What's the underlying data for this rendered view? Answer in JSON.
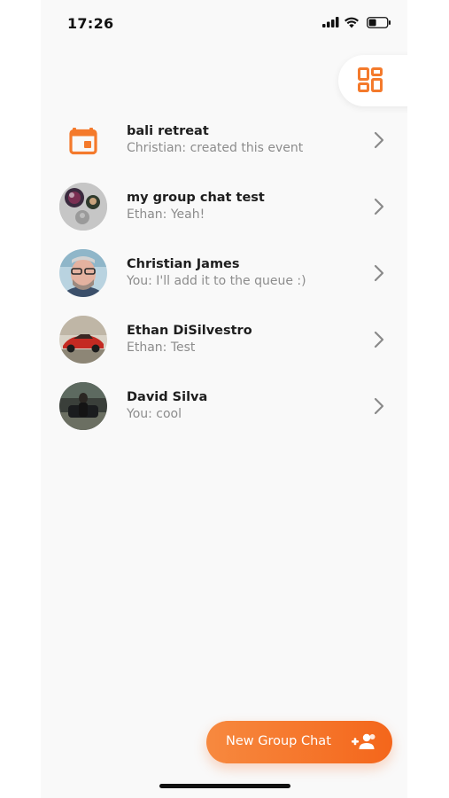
{
  "status_bar": {
    "time": "17:26"
  },
  "chats": [
    {
      "title": "bali retreat",
      "preview": "Christian: created this event",
      "avatar": "calendar-icon"
    },
    {
      "title": "my group chat test",
      "preview": "Ethan: Yeah!",
      "avatar": "group-avatar"
    },
    {
      "title": "Christian James",
      "preview": "You: I'll add it to the queue :)",
      "avatar": "photo-avatar"
    },
    {
      "title": "Ethan DiSilvestro",
      "preview": "Ethan: Test",
      "avatar": "photo-avatar"
    },
    {
      "title": "David Silva",
      "preview": "You: cool",
      "avatar": "photo-avatar"
    }
  ],
  "fab": {
    "label": "New Group Chat",
    "icon": "group-add-icon"
  },
  "colors": {
    "accent": "#f47a2c",
    "background": "#f9f9f9",
    "title": "#1e1e1e",
    "preview": "#8c8c8c"
  }
}
